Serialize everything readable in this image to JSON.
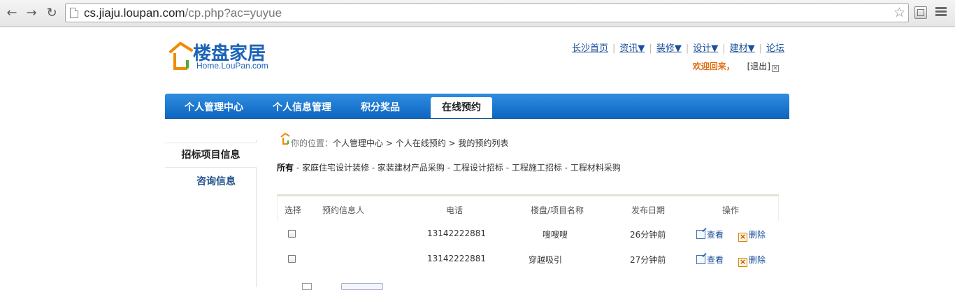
{
  "browser": {
    "url_host": "cs.jiaju.loupan.com",
    "url_path": "/cp.php?ac=yuyue"
  },
  "logo": {
    "cn": "楼盘家居",
    "en": "Home.LouPan.com"
  },
  "topnav": {
    "items": [
      "长沙首页",
      "资讯▼",
      "装修▼",
      "设计▼",
      "建材▼",
      "论坛"
    ]
  },
  "welcome": {
    "greeting": "欢迎回来，",
    "logout": "[退出]"
  },
  "tabs": [
    "个人管理中心",
    "个人信息管理",
    "积分奖品",
    "在线预约"
  ],
  "sidebar": {
    "items": [
      "招标项目信息",
      "咨询信息"
    ]
  },
  "breadcrumb": {
    "label": "你的位置：",
    "path": "个人管理中心 > 个人在线预约 > 我的预约列表"
  },
  "filters": {
    "all": "所有",
    "rest": " - 家庭住宅设计装修 - 家装建材产品采购 - 工程设计招标 - 工程施工招标 - 工程材料采购"
  },
  "table": {
    "headers": [
      "选择",
      "预约信息人",
      "电话",
      "楼盘/项目名称",
      "发布日期",
      "操作"
    ],
    "rows": [
      {
        "person": "",
        "phone": "13142222881",
        "project": "嗖嗖嗖",
        "date": "26分钟前",
        "view": "查看",
        "delete": "删除"
      },
      {
        "person": "",
        "phone": "13142222881",
        "project": "穿越吸引",
        "date": "27分钟前",
        "view": "查看",
        "delete": "删除"
      }
    ]
  },
  "colors": {
    "tab_blue": "#1574cf",
    "link_blue": "#1a4f99",
    "welcome_orange": "#e06d10"
  }
}
